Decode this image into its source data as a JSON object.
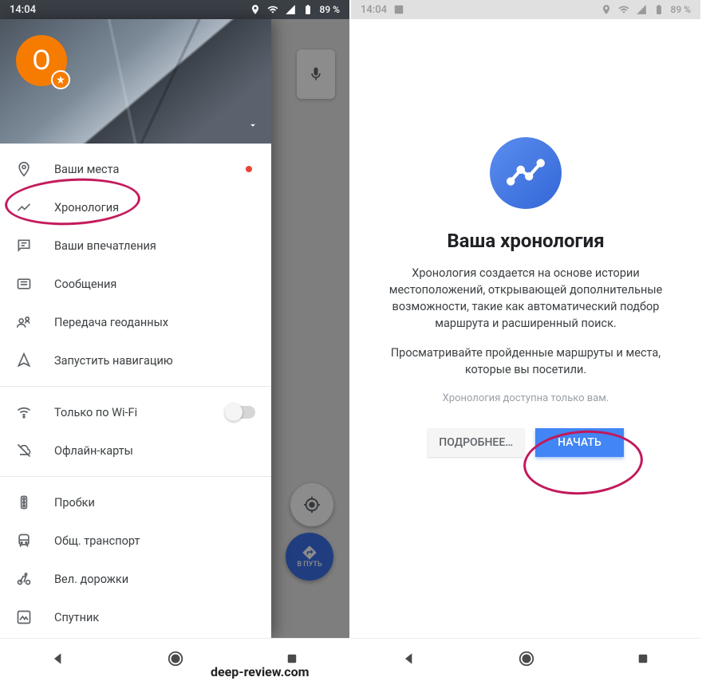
{
  "status": {
    "time": "14:04",
    "battery": "89 %"
  },
  "drawer": {
    "avatar_letter": "О",
    "items": [
      {
        "label": "Ваши места",
        "has_dot": true
      },
      {
        "label": "Хронология"
      },
      {
        "label": "Ваши впечатления"
      },
      {
        "label": "Сообщения"
      },
      {
        "label": "Передача геоданных"
      },
      {
        "label": "Запустить навигацию"
      }
    ],
    "items2": [
      {
        "label": "Только по Wi-Fi",
        "toggle": true
      },
      {
        "label": "Офлайн-карты"
      }
    ],
    "items3": [
      {
        "label": "Пробки"
      },
      {
        "label": "Общ. транспорт"
      },
      {
        "label": "Вел. дорожки"
      },
      {
        "label": "Спутник"
      }
    ]
  },
  "go_fab": "В ПУТЬ",
  "timeline": {
    "title": "Ваша хронология",
    "p1": "Хронология создается на основе истории местоположений, открывающей дополнительные возможности, такие как автоматический подбор маршрута и расширенный поиск.",
    "p2": "Просматривайте пройденные маршруты и места, которые вы посетили.",
    "sub": "Хронология доступна только вам.",
    "more_btn": "ПОДРОБНЕЕ…",
    "start_btn": "НАЧАТЬ"
  },
  "watermark": "deep-review.com"
}
